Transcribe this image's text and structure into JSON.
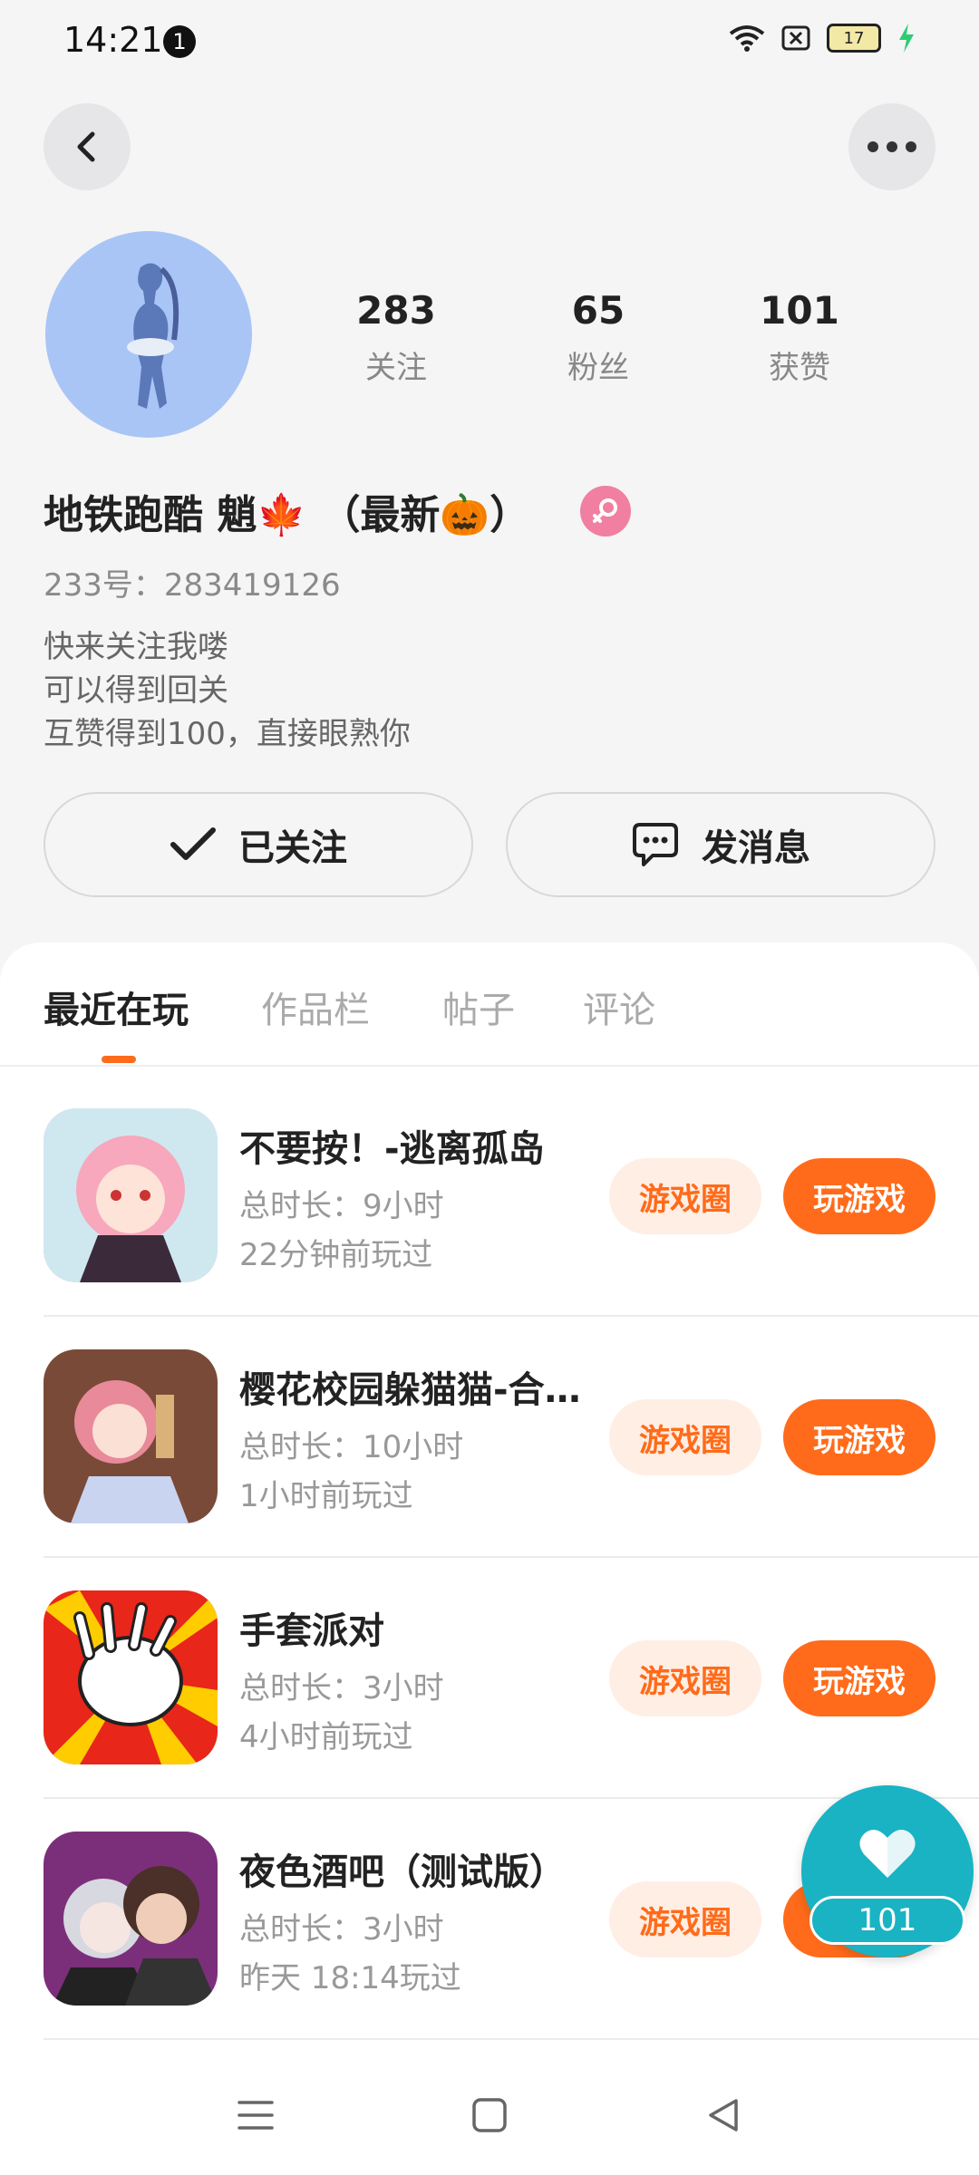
{
  "status_bar": {
    "time": "14:21",
    "notification_count": "1",
    "battery": "17"
  },
  "profile": {
    "name": "地铁跑酷 魈🍁 （最新🎃）",
    "uid": "233号：283419126",
    "bio": [
      "快来关注我喽",
      "可以得到回关",
      "互赞得到100，直接眼熟你"
    ],
    "stats": [
      {
        "value": "283",
        "label": "关注"
      },
      {
        "value": "65",
        "label": "粉丝"
      },
      {
        "value": "101",
        "label": "获赞"
      }
    ],
    "follow_label": "已关注",
    "message_label": "发消息"
  },
  "tabs": [
    "最近在玩",
    "作品栏",
    "帖子",
    "评论"
  ],
  "games": [
    {
      "title": "不要按！-逃离孤岛",
      "duration": "总时长：9小时",
      "last_played": "22分钟前玩过",
      "circle_label": "游戏圈",
      "play_label": "玩游戏"
    },
    {
      "title": "樱花校园躲猫猫-合…",
      "duration": "总时长：10小时",
      "last_played": "1小时前玩过",
      "circle_label": "游戏圈",
      "play_label": "玩游戏"
    },
    {
      "title": "手套派对",
      "duration": "总时长：3小时",
      "last_played": "4小时前玩过",
      "circle_label": "游戏圈",
      "play_label": "玩游戏"
    },
    {
      "title": "夜色酒吧（测试版）",
      "duration": "总时长：3小时",
      "last_played": "昨天 18:14玩过",
      "circle_label": "游戏圈",
      "play_label": "玩游戏"
    }
  ],
  "like_fab": {
    "count": "101"
  },
  "colors": {
    "accent": "#ff6b1a",
    "accent_light": "#ffeee4",
    "fab": "#19b3c4",
    "avatar_bg": "#a9c5f5",
    "gender": "#f17fa2"
  }
}
